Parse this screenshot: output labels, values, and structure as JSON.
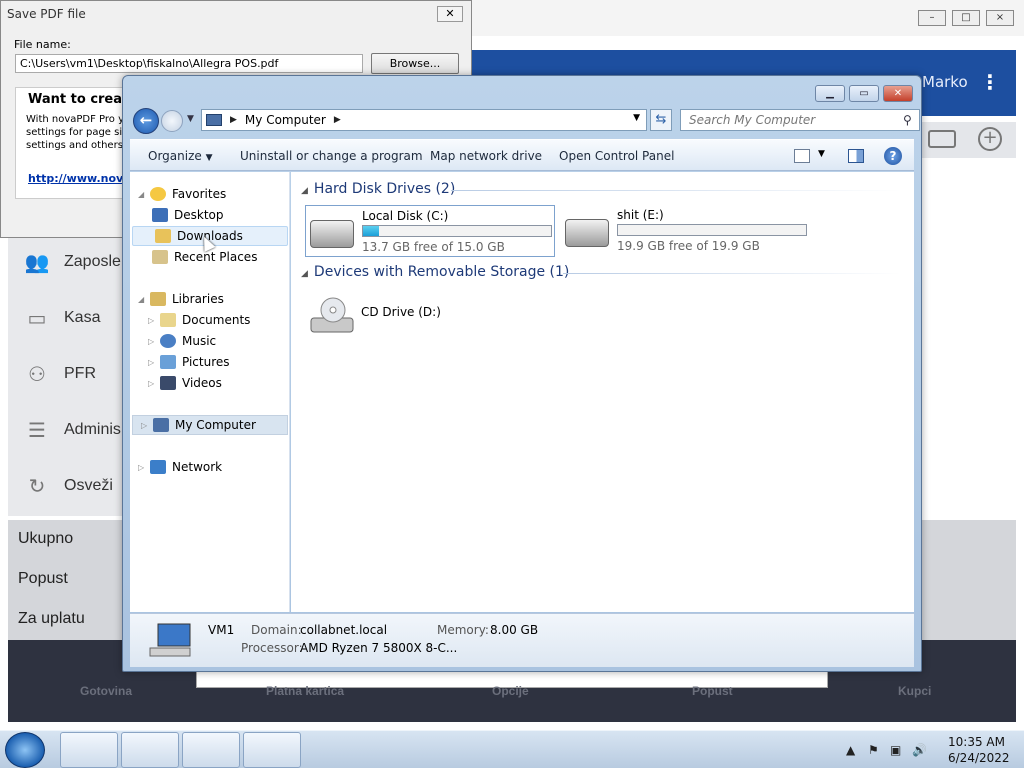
{
  "pos": {
    "user": "Marko",
    "nav": [
      "Zaposle",
      "Kasa",
      "PFR",
      "Adminis",
      "Osveži"
    ],
    "totals": [
      "Ukupno",
      "Popust",
      "Za uplatu"
    ],
    "bottom": [
      "Gotovina",
      "Platna kartica",
      "Opcije",
      "Popust",
      "Kupci"
    ]
  },
  "save_pdf": {
    "title": "Save PDF file",
    "file_name_label": "File name:",
    "file_name_value": "C:\\Users\\vm1\\Desktop\\fiskalno\\Allegra POS.pdf",
    "browse_label": "Browse...",
    "promo_heading": "Want to create",
    "promo_lines": [
      "With novaPDF Pro y",
      "settings for page siz",
      "settings and others."
    ],
    "promo_link": "http://www.nova"
  },
  "explorer": {
    "address_crumb": "My Computer",
    "search_placeholder": "Search My Computer",
    "commands": [
      "Organize",
      "Uninstall or change a program",
      "Map network drive",
      "Open Control Panel"
    ],
    "nav": {
      "favorites": "Favorites",
      "fav_items": [
        "Desktop",
        "Downloads",
        "Recent Places"
      ],
      "libraries": "Libraries",
      "lib_items": [
        "Documents",
        "Music",
        "Pictures",
        "Videos"
      ],
      "computer": "My Computer",
      "network": "Network"
    },
    "groups": {
      "hdd": "Hard Disk Drives (2)",
      "removable": "Devices with Removable Storage (1)"
    },
    "drives": [
      {
        "name": "Local Disk (C:)",
        "free": "13.7 GB free of 15.0 GB",
        "used_fraction": 0.087
      },
      {
        "name": "shit (E:)",
        "free": "19.9 GB free of 19.9 GB",
        "used_fraction": 0.0
      }
    ],
    "cd": {
      "name": "CD Drive (D:)"
    },
    "details": {
      "name": "VM1",
      "domain_label": "Domain:",
      "domain": "collabnet.local",
      "memory_label": "Memory:",
      "memory": "8.00 GB",
      "processor_label": "Processor:",
      "processor": "AMD Ryzen 7 5800X 8-C..."
    }
  },
  "taskbar": {
    "time": "10:35 AM",
    "date": "6/24/2022"
  },
  "colors": {
    "accent": "#1d4fa0",
    "drive_fill": "#1b9fd8"
  }
}
